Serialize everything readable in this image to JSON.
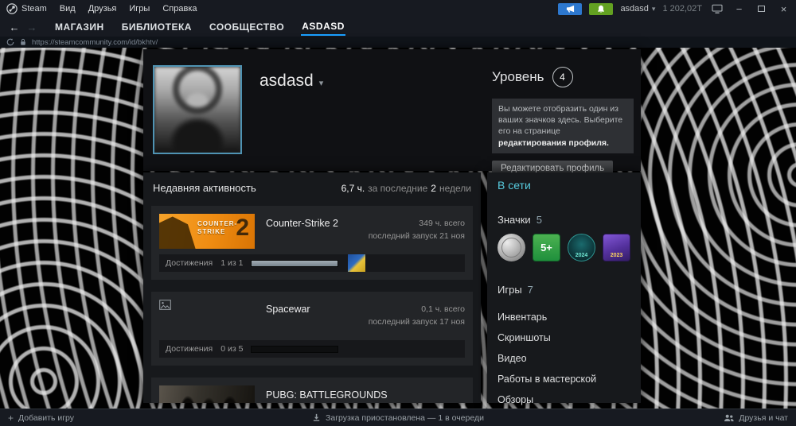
{
  "titlebar": {
    "app_name": "Steam",
    "menu": [
      "Вид",
      "Друзья",
      "Игры",
      "Справка"
    ],
    "account_name": "asdasd",
    "balance": "1 202,02T"
  },
  "icons": {
    "back": "←",
    "forward": "→",
    "caret_down": "▾",
    "minimize": "−",
    "close": "×",
    "plus": "+"
  },
  "nav": {
    "store": "МАГАЗИН",
    "library": "БИБЛИОТЕКА",
    "community": "СООБЩЕСТВО",
    "profile": "ASDASD"
  },
  "urlbar": {
    "url": "https://steamcommunity.com/id/bkhtv/"
  },
  "profile": {
    "persona": "asdasd",
    "level_label": "Уровень",
    "level_value": "4",
    "badge_hint_text": "Вы можете отобразить один из ваших значков здесь. Выберите его на странице",
    "badge_hint_link": "редактирования профиля.",
    "edit_button": "Редактировать профиль"
  },
  "activity": {
    "title": "Недавняя активность",
    "summary_hours": "6,7 ч.",
    "summary_mid": "за последние",
    "summary_weeks": "2",
    "summary_tail": "недели",
    "games": [
      {
        "name": "Counter-Strike 2",
        "hours_total": "349 ч. всего",
        "last_played": "последний запуск 21 ноя",
        "achievements_label": "Достижения",
        "achievements_count": "1 из 1",
        "progress_pct": 100,
        "capsule": {
          "line1": "COUNTER-",
          "line2": "STRIKE",
          "number": "2"
        }
      },
      {
        "name": "Spacewar",
        "hours_total": "0,1 ч. всего",
        "last_played": "последний запуск 17 ноя",
        "achievements_label": "Достижения",
        "achievements_count": "0 из 5",
        "progress_pct": 0
      },
      {
        "name": "PUBG: BATTLEGROUNDS"
      }
    ]
  },
  "sidebar": {
    "online_status": "В сети",
    "badges_label": "Значки",
    "badges_count": "5",
    "badges": [
      {
        "name": "silver-medal-badge",
        "text": ""
      },
      {
        "name": "five-plus-badge",
        "text": "5+"
      },
      {
        "name": "winter-2024-badge",
        "text": "2024"
      },
      {
        "name": "awards-2023-badge",
        "text": "2023"
      }
    ],
    "games_label": "Игры",
    "games_count": "7",
    "links": [
      "Инвентарь",
      "Скриншоты",
      "Видео",
      "Работы в мастерской",
      "Обзоры"
    ]
  },
  "statusbar": {
    "add_game": "Добавить игру",
    "download_status": "Загрузка приостановлена — 1 в очереди",
    "friends": "Друзья и чат"
  }
}
